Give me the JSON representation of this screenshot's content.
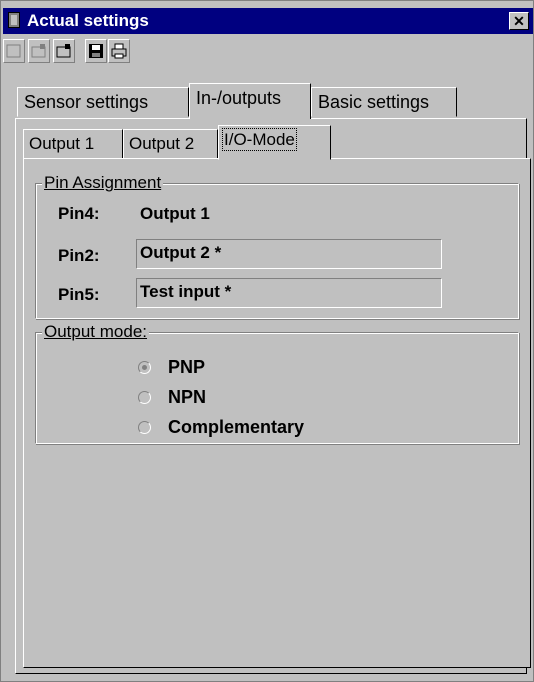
{
  "window": {
    "title": "Actual settings",
    "close_glyph": "✕"
  },
  "toolbar": {
    "buttons": [
      {
        "icon": "blank-page-icon"
      },
      {
        "icon": "edit-window-icon"
      },
      {
        "icon": "export-window-icon"
      },
      {
        "icon": "save-disk-icon"
      },
      {
        "icon": "printer-icon"
      }
    ]
  },
  "tabs": [
    {
      "label": "Sensor settings"
    },
    {
      "label": "In-/outputs",
      "active": true
    },
    {
      "label": "Basic settings"
    }
  ],
  "subtabs": [
    {
      "label": "Output 1"
    },
    {
      "label": "Output 2"
    },
    {
      "label": "I/O-Mode",
      "active": true
    }
  ],
  "pin_assignment": {
    "legend": "Pin Assignment",
    "rows": [
      {
        "label": "Pin4:",
        "value": "Output 1"
      },
      {
        "label": "Pin2:",
        "value": "Output 2 *"
      },
      {
        "label": "Pin5:",
        "value": "Test input *"
      }
    ]
  },
  "output_mode": {
    "legend": "Output mode:",
    "options": [
      {
        "label": "PNP",
        "selected": true
      },
      {
        "label": "NPN",
        "selected": false
      },
      {
        "label": "Complementary",
        "selected": false
      }
    ]
  },
  "colors": {
    "face": "#c0c0c0",
    "titlebar": "#000080",
    "shadow": "#808080",
    "highlight": "#ffffff"
  }
}
